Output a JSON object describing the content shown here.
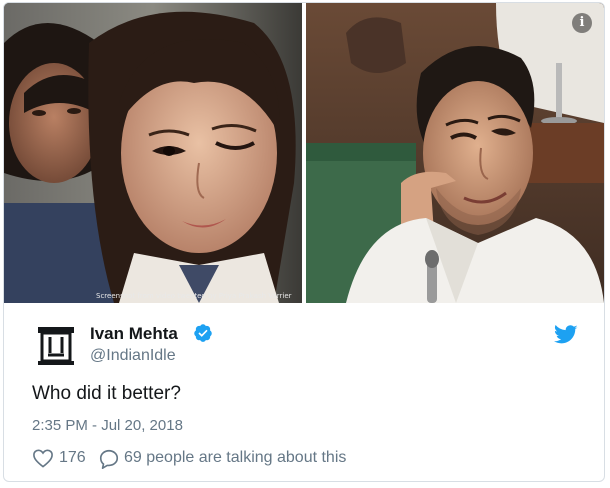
{
  "media": {
    "caption": "Screenshot from video tweeted by Priya Prakash Varrier",
    "left_photo_alt": "Girl winking in school uniform",
    "right_photo_alt": "Man winking in parliament",
    "info_icon": "info-icon"
  },
  "tweet": {
    "author_name": "Ivan Mehta",
    "author_handle": "@IndianIdle",
    "text": "Who did it better?",
    "timestamp": "2:35 PM - Jul 20, 2018",
    "likes": "176",
    "replies_text": "69 people are talking about this"
  },
  "colors": {
    "twitter_blue": "#1da1f2",
    "secondary_text": "#657786",
    "primary_text": "#14171a",
    "border": "#d8dee4"
  },
  "icons": [
    "info-icon",
    "verified-badge-icon",
    "twitter-bird-icon",
    "heart-icon",
    "speech-bubble-icon"
  ]
}
